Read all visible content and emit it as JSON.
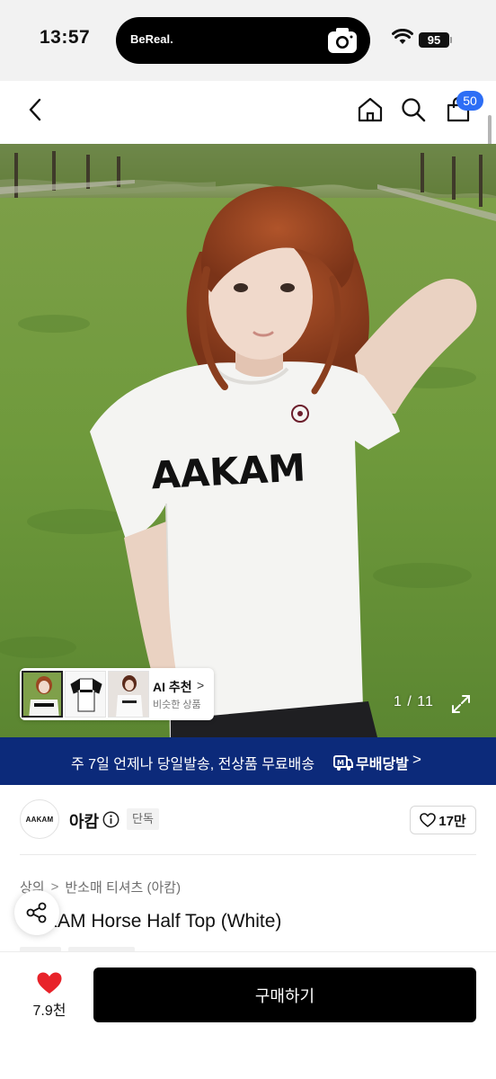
{
  "status_bar": {
    "time": "13:57",
    "island_app": "BeReal.",
    "battery": "95"
  },
  "nav": {
    "cart_count": "50"
  },
  "gallery": {
    "counter": "1 / 11",
    "shirt_print": "AAKAM",
    "ai_card": {
      "title": "AI 추천",
      "arrow": ">",
      "subtitle": "비슷한 상품"
    }
  },
  "promo": {
    "text": "주 7일 언제나 당일발송, 전상품 무료배송",
    "logo_label": "무배당발",
    "arrow": ">"
  },
  "brand": {
    "logo_text": "AAKAM",
    "name": "아캄",
    "badge": "단독",
    "likes": "17만"
  },
  "product": {
    "breadcrumb": [
      "상의",
      "반소매 티셔츠 (아캄)"
    ],
    "breadcrumb_separator": ">",
    "title": "AAKAM Horse Half Top (White)"
  },
  "bottom": {
    "wish_count": "7.9천",
    "buy_label": "구매하기"
  },
  "colors": {
    "accent_blue": "#2d6ef5",
    "promo_navy": "#0c2a7a",
    "heart_red": "#e8232a",
    "buy_black": "#000000"
  },
  "icons": {
    "back": "chevron-left-icon",
    "home": "home-icon",
    "search": "search-icon",
    "cart": "shopping-bag-icon",
    "expand": "expand-icon",
    "share": "share-icon",
    "info": "info-icon",
    "like": "heart-outline-icon",
    "wish": "heart-filled-icon"
  }
}
